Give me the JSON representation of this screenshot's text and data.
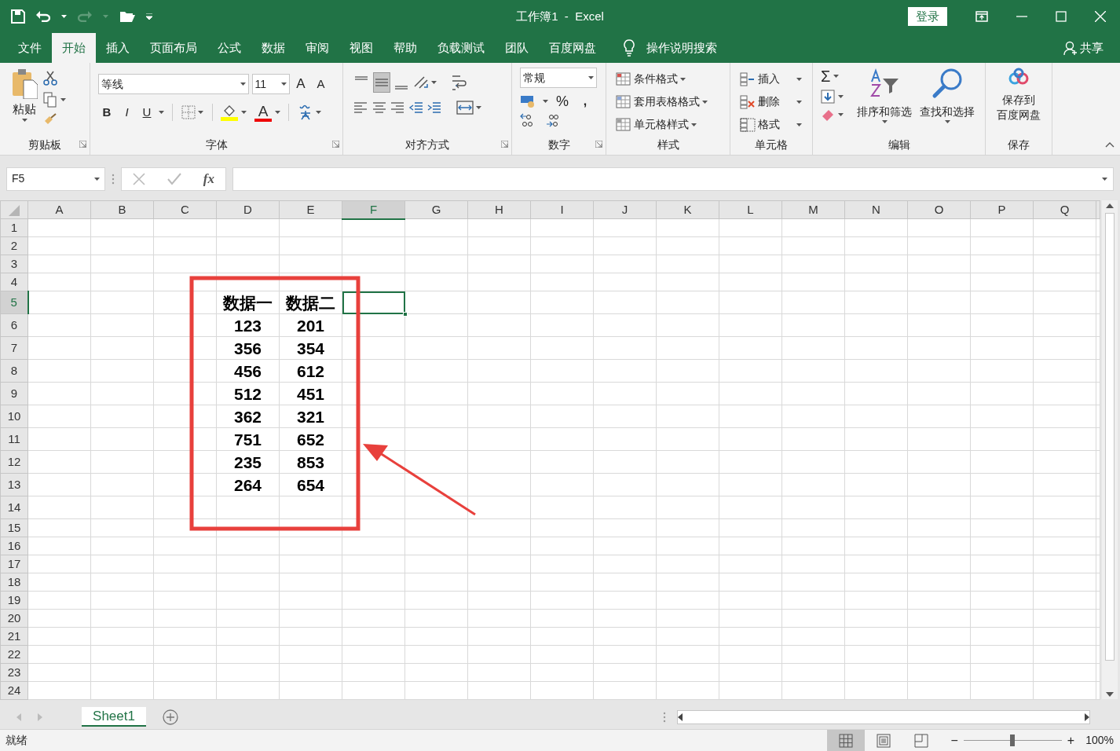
{
  "window": {
    "title": "工作簿1  -  Excel",
    "sign_in": "登录"
  },
  "menu_tabs": [
    {
      "label": "文件",
      "selected": false
    },
    {
      "label": "开始",
      "selected": true
    },
    {
      "label": "插入",
      "selected": false
    },
    {
      "label": "页面布局",
      "selected": false
    },
    {
      "label": "公式",
      "selected": false
    },
    {
      "label": "数据",
      "selected": false
    },
    {
      "label": "审阅",
      "selected": false
    },
    {
      "label": "视图",
      "selected": false
    },
    {
      "label": "帮助",
      "selected": false
    },
    {
      "label": "负载测试",
      "selected": false
    },
    {
      "label": "团队",
      "selected": false
    },
    {
      "label": "百度网盘",
      "selected": false
    }
  ],
  "tell_me": "操作说明搜索",
  "share": "共享",
  "ribbon": {
    "clipboard": {
      "label": "剪贴板",
      "paste": "粘贴"
    },
    "font": {
      "label": "字体",
      "font_name": "等线",
      "font_size": "11",
      "grow": "A",
      "shrink": "A",
      "bold": "B",
      "italic": "I",
      "underline": "U",
      "font_color": "A"
    },
    "alignment": {
      "label": "对齐方式",
      "vertical": [
        {
          "selected": false
        },
        {
          "selected": true
        },
        {
          "selected": false
        }
      ]
    },
    "number": {
      "label": "数字",
      "format": "常规",
      "percent": "%",
      "comma": ","
    },
    "styles": {
      "label": "样式",
      "buttons": [
        "条件格式",
        "套用表格格式",
        "单元格样式"
      ]
    },
    "cells": {
      "label": "单元格",
      "buttons": [
        "插入",
        "删除",
        "格式"
      ]
    },
    "editing": {
      "label": "编辑",
      "sum": "Σ",
      "buttons": [
        "排序和筛选",
        "查找和选择"
      ]
    },
    "save": {
      "label": "保存",
      "button": [
        "保存到",
        "百度网盘"
      ]
    }
  },
  "formula_bar": {
    "name_box": "F5",
    "fx": "fx"
  },
  "sheet": {
    "columns": [
      {
        "label": "A",
        "selected": false
      },
      {
        "label": "B",
        "selected": false
      },
      {
        "label": "C",
        "selected": false
      },
      {
        "label": "D",
        "selected": false
      },
      {
        "label": "E",
        "selected": false
      },
      {
        "label": "F",
        "selected": true
      },
      {
        "label": "G",
        "selected": false
      },
      {
        "label": "H",
        "selected": false
      },
      {
        "label": "I",
        "selected": false
      },
      {
        "label": "J",
        "selected": false
      },
      {
        "label": "K",
        "selected": false
      },
      {
        "label": "L",
        "selected": false
      },
      {
        "label": "M",
        "selected": false
      },
      {
        "label": "N",
        "selected": false
      },
      {
        "label": "O",
        "selected": false
      },
      {
        "label": "P",
        "selected": false
      },
      {
        "label": "Q",
        "selected": false
      }
    ],
    "rows": [
      {
        "header": "1",
        "selected": false,
        "tall": false
      },
      {
        "header": "2",
        "selected": false,
        "tall": false
      },
      {
        "header": "3",
        "selected": false,
        "tall": false
      },
      {
        "header": "4",
        "selected": false,
        "tall": false
      },
      {
        "header": "5",
        "selected": true,
        "tall": true,
        "d": "数据一",
        "e": "数据二"
      },
      {
        "header": "6",
        "selected": false,
        "tall": true,
        "d": "123",
        "e": "201"
      },
      {
        "header": "7",
        "selected": false,
        "tall": true,
        "d": "356",
        "e": "354"
      },
      {
        "header": "8",
        "selected": false,
        "tall": true,
        "d": "456",
        "e": "612"
      },
      {
        "header": "9",
        "selected": false,
        "tall": true,
        "d": "512",
        "e": "451"
      },
      {
        "header": "10",
        "selected": false,
        "tall": true,
        "d": "362",
        "e": "321"
      },
      {
        "header": "11",
        "selected": false,
        "tall": true,
        "d": "751",
        "e": "652"
      },
      {
        "header": "12",
        "selected": false,
        "tall": true,
        "d": "235",
        "e": "853"
      },
      {
        "header": "13",
        "selected": false,
        "tall": true,
        "d": "264",
        "e": "654"
      },
      {
        "header": "14",
        "selected": false,
        "tall": true
      },
      {
        "header": "15",
        "selected": false,
        "tall": false
      },
      {
        "header": "16",
        "selected": false,
        "tall": false
      },
      {
        "header": "17",
        "selected": false,
        "tall": false
      },
      {
        "header": "18",
        "selected": false,
        "tall": false
      },
      {
        "header": "19",
        "selected": false,
        "tall": false
      },
      {
        "header": "20",
        "selected": false,
        "tall": false
      },
      {
        "header": "21",
        "selected": false,
        "tall": false
      },
      {
        "header": "22",
        "selected": false,
        "tall": false
      },
      {
        "header": "23",
        "selected": false,
        "tall": false
      },
      {
        "header": "24",
        "selected": false,
        "tall": false
      }
    ],
    "annotations": {
      "highlight_box": true,
      "arrow": true
    }
  },
  "sheet_tabs": [
    {
      "label": "Sheet1",
      "selected": true
    }
  ],
  "status_bar": {
    "text": "就绪",
    "views": [
      {
        "kind": "normal",
        "selected": true
      },
      {
        "kind": "page_layout",
        "selected": false
      },
      {
        "kind": "page_break",
        "selected": false
      }
    ],
    "zoom_out": "−",
    "zoom_in": "+",
    "zoom": {
      "level": 0.5
    },
    "percent": "100%"
  }
}
